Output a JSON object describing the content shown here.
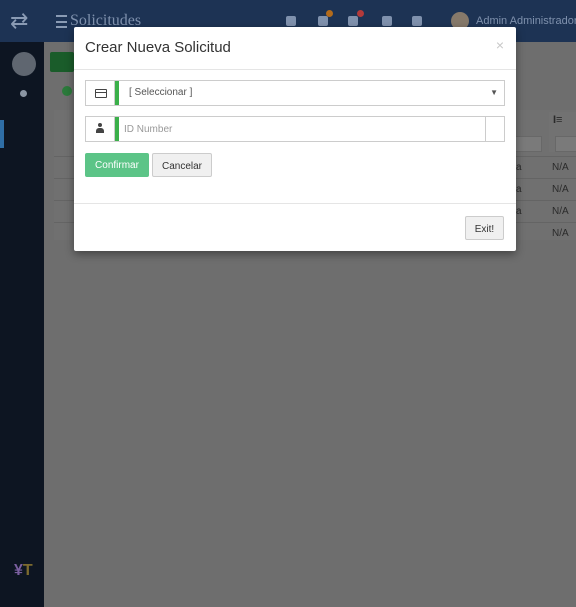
{
  "app": {
    "title": "Solicitudes",
    "user_name": "Admin Administrador",
    "logo_letters": "T"
  },
  "background_table": {
    "cells_a": [
      "a",
      "a",
      "a"
    ],
    "cells_na": [
      "N/A",
      "N/A",
      "N/A",
      "N/A"
    ]
  },
  "modal": {
    "title": "Crear Nueva Solicitud",
    "close_label": "×",
    "select": {
      "selected": "[ Seleccionar ]",
      "icon": "credit-card-icon"
    },
    "id_field": {
      "placeholder": "ID Number",
      "value": "",
      "icon": "user-icon"
    },
    "confirm_label": "Confirmar",
    "cancel_label": "Cancelar",
    "exit_label": "Exit!"
  },
  "colors": {
    "accent_green": "#3bb04a",
    "confirm_button": "#5cc487",
    "topbar": "#1d3354"
  }
}
